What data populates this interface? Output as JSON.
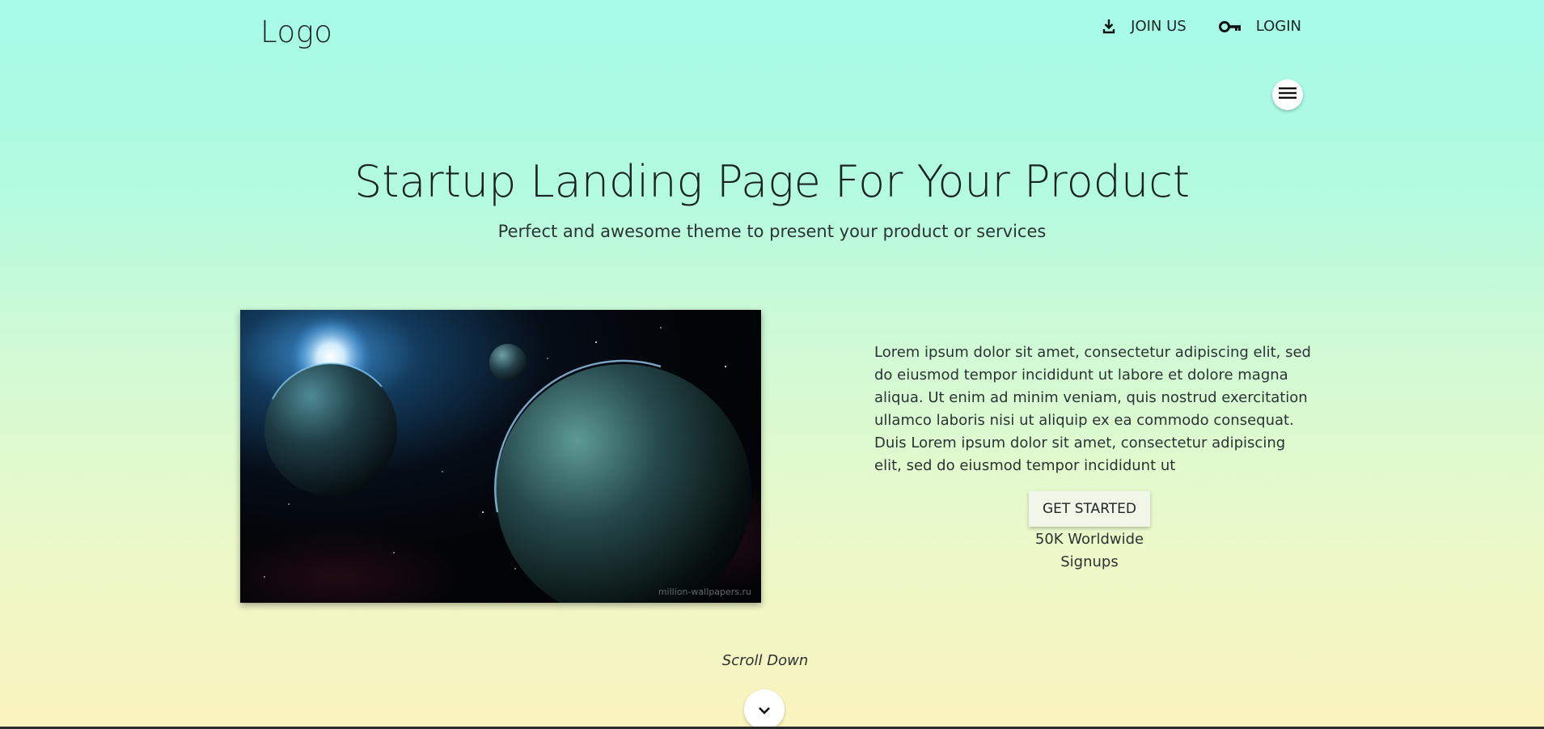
{
  "header": {
    "logo": "Logo",
    "nav": [
      {
        "label": "JOIN US",
        "icon": "download-icon"
      },
      {
        "label": "LOGIN",
        "icon": "key-icon"
      }
    ],
    "menu_icon": "menu-icon"
  },
  "hero": {
    "title": "Startup Landing Page For Your Product",
    "subtitle": "Perfect and awesome theme to present your product or services"
  },
  "image": {
    "watermark": "million-wallpapers.ru"
  },
  "content": {
    "description": "Lorem ipsum dolor sit amet, consectetur adipiscing elit, sed do eiusmod tempor incididunt ut labore et dolore magna aliqua. Ut enim ad minim veniam, quis nostrud exercitation ullamco laboris nisi ut aliquip ex ea commodo consequat. Duis Lorem ipsum dolor sit amet, consectetur adipiscing elit, sed do eiusmod tempor incididunt ut",
    "cta_label": "GET STARTED",
    "signups": "50K Worldwide Signups"
  },
  "scroll": {
    "label": "Scroll Down",
    "icon": "chevron-down-icon"
  }
}
